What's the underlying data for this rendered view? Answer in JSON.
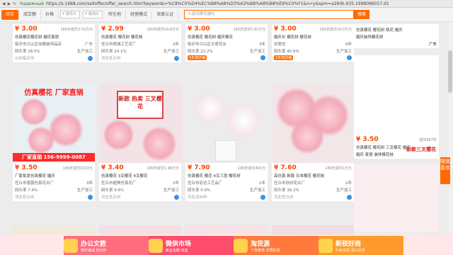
{
  "browser": {
    "secure_label": "Надежный",
    "url": "https://s.1688.com/selloffer/offer_search.htm?keywords=%C8%C0%D4%EC%B8%A8%D3%A3%BB%A8%B8%E9%C0%F1&n=y&spm=a260k.635.1998096057.d1"
  },
  "filters": {
    "tabs": [
      "综合",
      "成交额",
      "价格"
    ],
    "price_from": "¥ 最低价",
    "price_to": "¥ 最高价",
    "extra_tabs": [
      "所在地",
      "经营模式",
      "深度认证"
    ],
    "search_placeholder": "人造花樱花婚礼",
    "search_button": "搜索"
  },
  "top_row": [
    {
      "price": "¥ 3.00",
      "sold": "180天成交3.52万元",
      "title": "仿真樱花樱花树 婚庆家居",
      "meta_left": "临沂市兰山区仙樱装饰品店",
      "meta_right": "广东",
      "rate": "回头率 28.5%",
      "kind": "生产加工",
      "loc": "山东临沂市"
    },
    {
      "price": "¥ 2.99",
      "sold": "180天成交14.6万元",
      "title": "仿真樱花 樱花树 樱花枝",
      "meta_left": "任丘市燕城工艺花厂",
      "meta_right": "2年",
      "rate": "回头率 24.1%",
      "kind": "生产加工",
      "loc": "河北任丘市"
    },
    {
      "price": "¥ 3.00",
      "sold": "180天成交5.92万元",
      "title": "仿真樱花 樱花树 婚庆樱花",
      "meta_left": "临沂市兰山区天骄花业",
      "meta_right": "3年",
      "rate": "回头率 22.2%",
      "kind": "生产加工",
      "loc": "5年老店铺"
    },
    {
      "price": "¥ 3.00",
      "sold": "180天成交19.0万元",
      "title": "婚庆长 樱花树 樱花枝",
      "meta_left": "刘爱仿",
      "meta_right": "6年",
      "rate": "回头率 40.6%",
      "kind": "生产加工",
      "loc": "5年老店铺"
    }
  ],
  "mid_row": [
    {
      "overlay": "仿真樱花 厂家直销",
      "banner": "厂家直销 156-9999-0087",
      "price": "¥ 3.50",
      "sold": "180天成交1314元",
      "title": "厂家批发仿真樱花 婚庆",
      "meta_left": "任丘市喜鹊仿真花卉厂",
      "meta_right": "3年",
      "rate": "回头率 7.4%",
      "kind": "生产加工",
      "loc": "河北任丘市"
    },
    {
      "overlay": "新款 热卖 三叉樱花",
      "banner": "",
      "price": "¥ 3.40",
      "sold": "180天成交1.98万元",
      "title": "仿真樱花 3叉樱花 4叉樱花",
      "meta_left": "任丘市超美仿真花厂",
      "meta_right": "2年",
      "rate": "回头率 9.6%",
      "kind": "生产加工",
      "loc": "河北任丘市"
    },
    {
      "overlay": "",
      "banner": "",
      "price": "¥ 7.90",
      "sold": "180天成交491元",
      "title": "仿真樱花 樱花 4叉三层 樱花树",
      "meta_left": "任丘市宏达工艺品厂",
      "meta_right": "1年",
      "rate": "回头率 0.0%",
      "kind": "生产加工",
      "loc": "河北沧州市"
    },
    {
      "overlay": "",
      "banner": "",
      "price": "¥ 7.60",
      "sold": "180天成交1万元",
      "title": "高仿真 新款 日本樱花 樱花枝",
      "meta_left": "任丘市欣欣花卉厂",
      "meta_right": "2年",
      "rate": "回头率 36.2%",
      "kind": "生产加工",
      "loc": "河北任丘市"
    }
  ],
  "side": {
    "top_title": "仿真樱花 樱花树 桃花 婚庆",
    "top_sub": "婚庆装饰樱花树",
    "top_meta": "广东",
    "overlay": "新款三叉樱花",
    "price": "¥ 3.50",
    "sold": "成交687件",
    "title": "仿真樱花 樱花树 三叉樱花 婚庆",
    "sub": "婚庆 家居 装饰樱花枝"
  },
  "side_tag": "猜我喜欢",
  "promos": [
    {
      "title": "办公文教",
      "sub": "限时满减 低价秒"
    },
    {
      "title": "微供市场",
      "sub": "新品包邮 夜店"
    },
    {
      "title": "淘货源",
      "sub": "个性推荐 优质好货"
    },
    {
      "title": "新锐好商",
      "sub": "升级货源 源头好货"
    }
  ],
  "colors": {
    "accent": "#ff6a00",
    "price": "#ff4400"
  }
}
